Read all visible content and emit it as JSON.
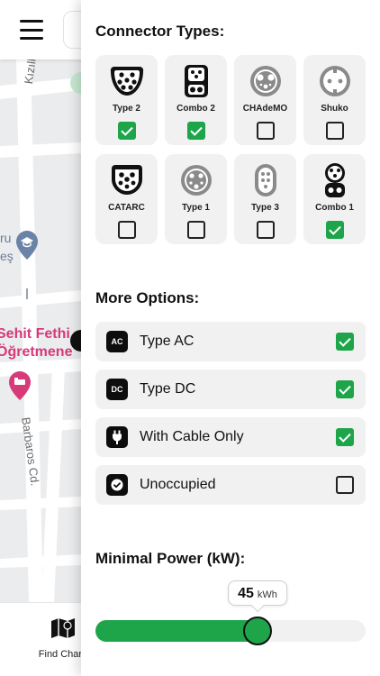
{
  "map": {
    "street_kizilkay": "Kızılkay",
    "street_barbaros": "Barbaros Cd.",
    "place_ru": "ru",
    "place_es": "eş",
    "place_sehit_1": "Sehit Fethi",
    "place_sehit_2": "Öğretmene",
    "bottom_nav_label": "Find Charg"
  },
  "filters": {
    "connector_title": "Connector Types:",
    "connectors": [
      {
        "label": "Type 2",
        "checked": true,
        "icon": "type2-connector-icon"
      },
      {
        "label": "Combo 2",
        "checked": true,
        "icon": "combo2-connector-icon"
      },
      {
        "label": "CHAdeMO",
        "checked": false,
        "icon": "chademo-connector-icon"
      },
      {
        "label": "Shuko",
        "checked": false,
        "icon": "shuko-connector-icon"
      },
      {
        "label": "CATARC",
        "checked": false,
        "icon": "catarc-connector-icon"
      },
      {
        "label": "Type 1",
        "checked": false,
        "icon": "type1-connector-icon"
      },
      {
        "label": "Type 3",
        "checked": false,
        "icon": "type3-connector-icon"
      },
      {
        "label": "Combo 1",
        "checked": true,
        "icon": "combo1-connector-icon"
      }
    ],
    "more_title": "More Options:",
    "options": [
      {
        "badge": "AC",
        "label": "Type AC",
        "checked": true
      },
      {
        "badge": "DC",
        "label": "Type DC",
        "checked": true
      },
      {
        "badge": "",
        "label": "With Cable Only",
        "checked": true,
        "icon": "plug-icon"
      },
      {
        "badge": "",
        "label": "Unoccupied",
        "checked": false,
        "icon": "check-circle-icon"
      }
    ],
    "power_title": "Minimal Power (kW):",
    "power": {
      "value": "45",
      "unit": "kWh",
      "fraction": 0.6
    }
  },
  "colors": {
    "accent": "#1ea54a",
    "dark": "#0d0d0d",
    "tile_bg": "#f1f1f2"
  }
}
